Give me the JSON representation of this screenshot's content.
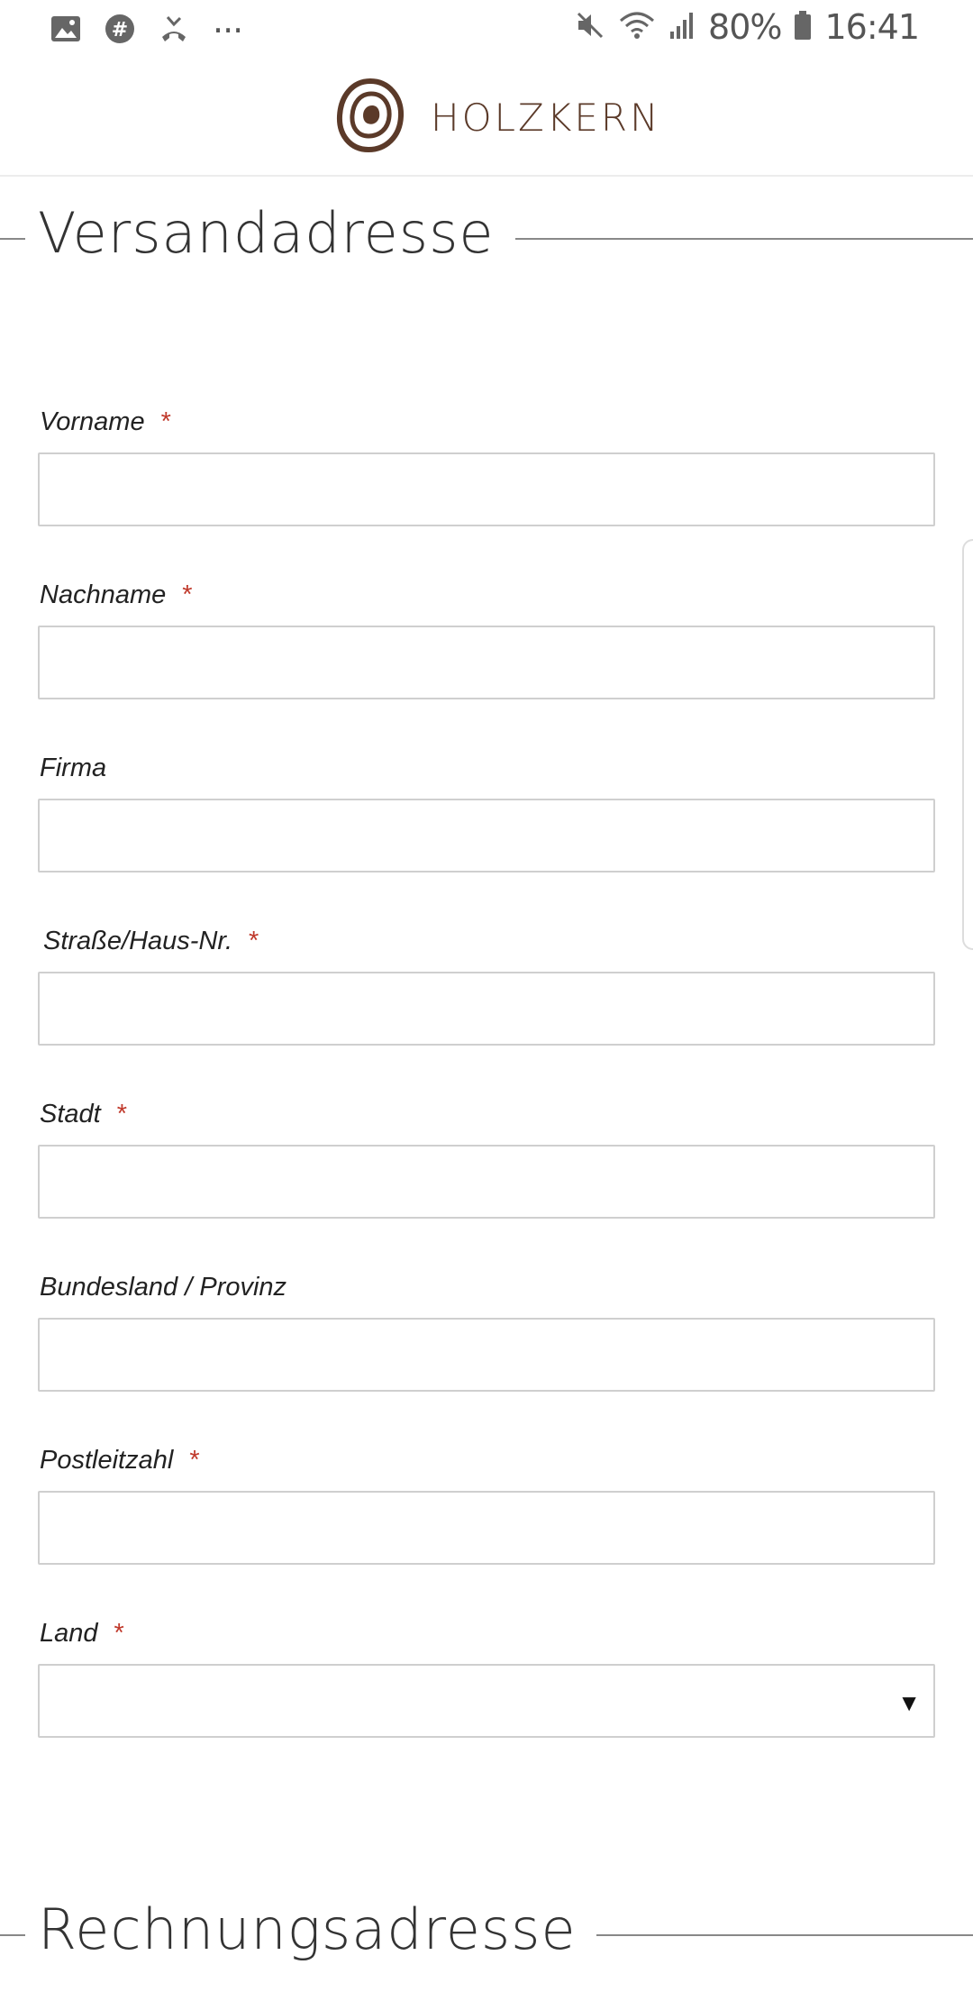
{
  "status_bar": {
    "icons_left": [
      "gallery-icon",
      "hashtag-app-icon",
      "missed-call-icon",
      "more-notifications-icon"
    ],
    "more_label": "···",
    "icons_right": [
      "mute-icon",
      "wifi-icon",
      "signal-icon",
      "battery-icon"
    ],
    "battery": "80%",
    "time": "16:41"
  },
  "header": {
    "brand": "HOLZKERN",
    "brand_color": "#5b3a29"
  },
  "shipping": {
    "title": "Versandadresse",
    "fields": [
      {
        "label": "Vorname",
        "required": "*",
        "value": ""
      },
      {
        "label": "Nachname",
        "required": "*",
        "value": ""
      },
      {
        "label": "Firma",
        "required": "",
        "value": ""
      },
      {
        "label": "Straße/Haus-Nr.",
        "required": "*",
        "value": ""
      },
      {
        "label": "Stadt",
        "required": "*",
        "value": ""
      },
      {
        "label": "Bundesland / Provinz",
        "required": "",
        "value": ""
      },
      {
        "label": "Postleitzahl",
        "required": "*",
        "value": ""
      },
      {
        "label": "Land",
        "required": "*",
        "value": "",
        "type": "select",
        "arrow": "▼"
      }
    ]
  },
  "billing": {
    "title": "Rechnungsadresse"
  },
  "colors": {
    "required_star": "#c0392b",
    "input_border": "#cfcfcf"
  }
}
